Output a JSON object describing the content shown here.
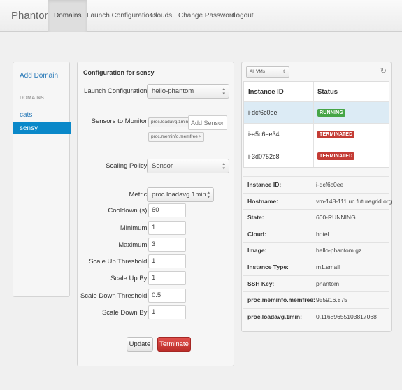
{
  "navbar": {
    "brand": "Phantom",
    "items": [
      "Domains",
      "Launch Configurations",
      "Clouds",
      "Change Password",
      "Logout"
    ]
  },
  "sidebar": {
    "add_domain": "Add Domain",
    "header": "DOMAINS",
    "domains": [
      "cats",
      "sensy"
    ],
    "selected": "sensy"
  },
  "config": {
    "title": "Configuration for sensy",
    "launch_configuration": {
      "label": "Launch Configuration:",
      "value": "hello-phantom"
    },
    "sensors": {
      "label": "Sensors to Monitor:",
      "tags": [
        "proc.loadavg.1min ×",
        "proc.meminfo.memfree ×"
      ],
      "placeholder": "Add Sensor"
    },
    "scaling_policy": {
      "label": "Scaling Policy:",
      "value": "Sensor"
    },
    "metric": {
      "label": "Metric:",
      "value": "proc.loadavg.1min"
    },
    "fields": [
      {
        "label": "Cooldown (s):",
        "value": "60"
      },
      {
        "label": "Minimum:",
        "value": "1"
      },
      {
        "label": "Maximum:",
        "value": "3"
      },
      {
        "label": "Scale Up Threshold:",
        "value": "1"
      },
      {
        "label": "Scale Up By:",
        "value": "1"
      },
      {
        "label": "Scale Down Threshold:",
        "value": "0.5"
      },
      {
        "label": "Scale Down By:",
        "value": "1"
      }
    ],
    "update_label": "Update",
    "terminate_label": "Terminate"
  },
  "vms": {
    "filter": "All VMs",
    "headers": [
      "Instance ID",
      "Status"
    ],
    "rows": [
      {
        "id": "i-dcf6c0ee",
        "status": "RUNNING",
        "color": "#46a546"
      },
      {
        "id": "i-a5c6ee34",
        "status": "TERMINATED",
        "color": "#c43c35"
      },
      {
        "id": "i-3d0752c8",
        "status": "TERMINATED",
        "color": "#c43c35"
      }
    ]
  },
  "details": [
    {
      "key": "Instance ID:",
      "value": "i-dcf6c0ee"
    },
    {
      "key": "Hostname:",
      "value": "vm-148-111.uc.futuregrid.org"
    },
    {
      "key": "State:",
      "value": "600-RUNNING"
    },
    {
      "key": "Cloud:",
      "value": "hotel"
    },
    {
      "key": "Image:",
      "value": "hello-phantom.gz"
    },
    {
      "key": "Instance Type:",
      "value": "m1.small"
    },
    {
      "key": "SSH Key:",
      "value": "phantom"
    },
    {
      "key": "proc.meminfo.memfree:",
      "value": "955916.875"
    },
    {
      "key": "proc.loadavg.1min:",
      "value": "0.11689655103817068"
    }
  ]
}
